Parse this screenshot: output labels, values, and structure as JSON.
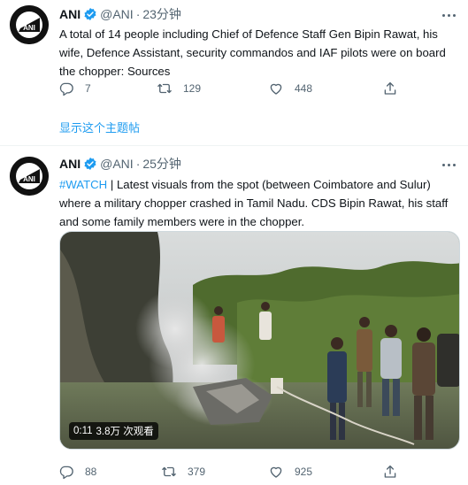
{
  "tweets": [
    {
      "author": {
        "name": "ANI",
        "handle": "@ANI",
        "avatar_text": "ANI"
      },
      "separator": "·",
      "time": "23分钟",
      "text": "A total of 14 people including Chief of Defence Staff Gen Bipin Rawat, his wife, Defence Assistant, security commandos and IAF pilots were on board the chopper: Sources",
      "replies": "7",
      "retweets": "129",
      "likes": "448",
      "show_thread": "显示这个主题帖"
    },
    {
      "author": {
        "name": "ANI",
        "handle": "@ANI",
        "avatar_text": "ANI"
      },
      "separator": "·",
      "time": "25分钟",
      "hashtag": "#WATCH",
      "text": " | Latest visuals from the spot (between Coimbatore and Sulur) where a military chopper crashed in Tamil Nadu. CDS Bipin Rawat, his staff and some family members were in the chopper.",
      "video": {
        "duration": "0:11",
        "views": "3.8万 次观看"
      },
      "replies": "88",
      "retweets": "379",
      "likes": "925"
    }
  ],
  "colors": {
    "accent": "#1d9bf0",
    "text": "#0f1419",
    "secondary": "#536471",
    "verified": "#1d9bf0"
  },
  "icons": [
    "ani-logo-icon",
    "verified-badge-icon",
    "more-icon",
    "reply-icon",
    "retweet-icon",
    "like-icon",
    "share-icon"
  ]
}
